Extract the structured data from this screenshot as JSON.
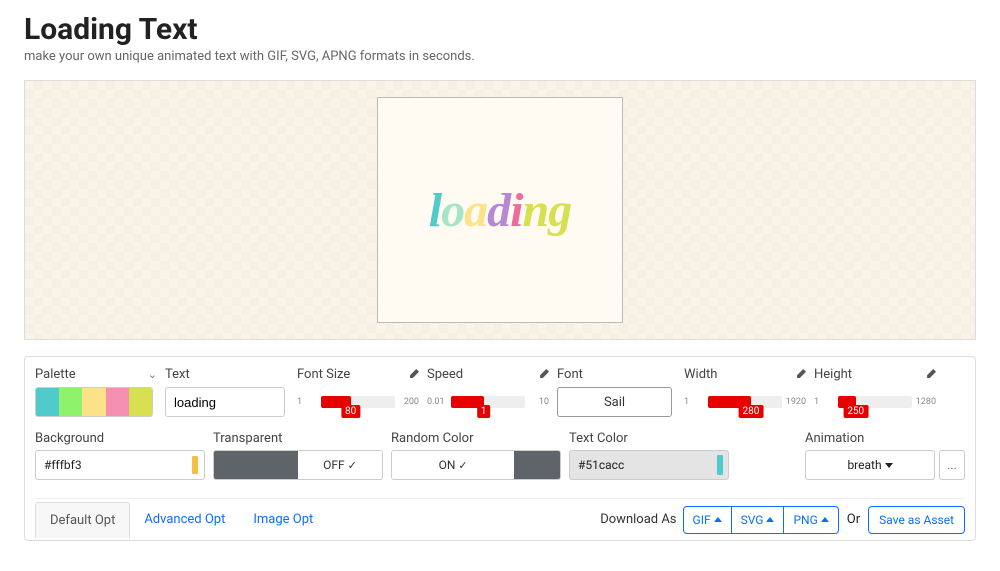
{
  "header": {
    "title": "Loading Text",
    "subtitle": "make your own unique animated text with GIF, SVG, APNG formats in seconds."
  },
  "preview": {
    "word": "loading",
    "canvas_bg": "#fffbf3"
  },
  "controls": {
    "palette": {
      "label": "Palette",
      "colors": [
        "#51cacc",
        "#a2f068",
        "#fce389",
        "#f48fb1",
        "#d6e051"
      ]
    },
    "text": {
      "label": "Text",
      "value": "loading"
    },
    "font_size": {
      "label": "Font Size",
      "min": "1",
      "max": "200",
      "value": "80",
      "fill_pct": 40,
      "badge_pct": 40
    },
    "speed": {
      "label": "Speed",
      "min": "0.01",
      "max": "10",
      "value": "1",
      "fill_pct": 44,
      "badge_pct": 44
    },
    "font": {
      "label": "Font",
      "value": "Sail"
    },
    "width": {
      "label": "Width",
      "min": "1",
      "max": "1920",
      "value": "280",
      "fill_pct": 58,
      "badge_pct": 58
    },
    "height": {
      "label": "Height",
      "min": "1",
      "max": "1280",
      "value": "250",
      "fill_pct": 24,
      "badge_pct": 24
    },
    "background": {
      "label": "Background",
      "value": "#fffbf3"
    },
    "transparent": {
      "label": "Transparent",
      "state": "OFF"
    },
    "random_color": {
      "label": "Random Color",
      "state": "ON"
    },
    "text_color": {
      "label": "Text Color",
      "value": "#51cacc"
    },
    "animation": {
      "label": "Animation",
      "value": "breath",
      "more": "..."
    }
  },
  "tabs": {
    "default": "Default Opt",
    "advanced": "Advanced Opt",
    "image": "Image Opt"
  },
  "download": {
    "label": "Download As",
    "gif": "GIF",
    "svg": "SVG",
    "png": "PNG",
    "or": "Or",
    "save": "Save as Asset"
  }
}
